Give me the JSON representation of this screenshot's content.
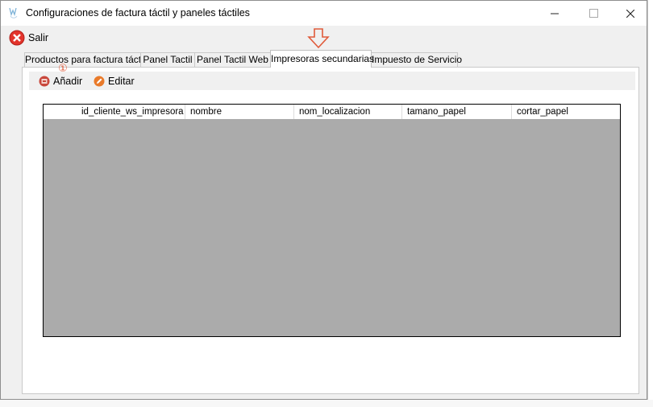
{
  "window": {
    "title": "Configuraciones de factura táctil y paneles táctiles",
    "app_icon": "w-app-icon"
  },
  "toolbar": {
    "exit_label": "Salir",
    "exit_icon": "close-circle-icon"
  },
  "tabs": [
    {
      "label": "Productos para factura táctil",
      "active": false
    },
    {
      "label": "Panel Tactil",
      "active": false
    },
    {
      "label": "Panel Tactil Web",
      "active": false
    },
    {
      "label": "Impresoras secundarias",
      "active": true
    },
    {
      "label": "Impuesto de Servicio",
      "active": false
    }
  ],
  "panel_toolbar": {
    "add_label": "Añadir",
    "edit_label": "Editar"
  },
  "grid": {
    "columns": [
      "id_cliente_ws_impresora",
      "nombre",
      "nom_localizacion",
      "tamano_papel",
      "cortar_papel"
    ],
    "rows": []
  },
  "annotations": {
    "step_marker": "①"
  },
  "colors": {
    "accent": "#e05a3a",
    "empty_grid": "#ababab"
  }
}
